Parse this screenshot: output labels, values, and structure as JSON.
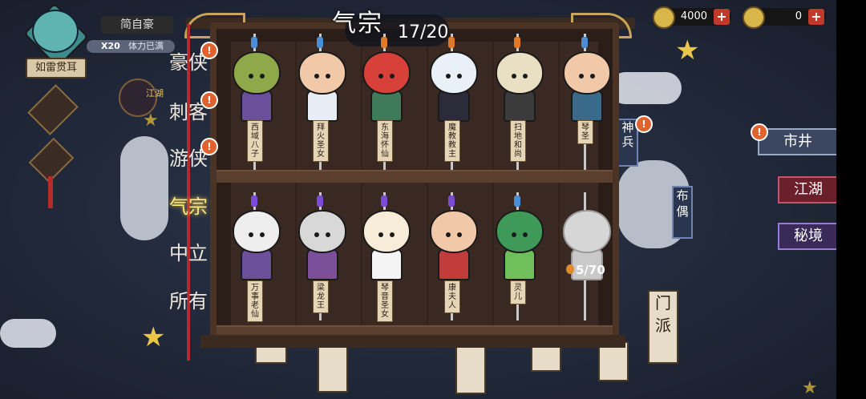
{
  "player": {
    "name": "简自豪",
    "stamina_count": "X20",
    "stamina_status": "体力已满",
    "title": "如雷贯耳"
  },
  "currency": [
    {
      "icon": "leaf-coin-icon",
      "value": "4000"
    },
    {
      "icon": "gold-ingot-icon",
      "value": "0"
    }
  ],
  "collection": {
    "category_label": "气宗",
    "count": "17/20"
  },
  "tabs": [
    {
      "label": "豪侠",
      "badge": "!"
    },
    {
      "label": "刺客",
      "badge": "!"
    },
    {
      "label": "游侠",
      "badge": "!"
    },
    {
      "label": "气宗",
      "badge": ""
    },
    {
      "label": "中立",
      "badge": ""
    },
    {
      "label": "所有",
      "badge": ""
    }
  ],
  "characters_top": [
    {
      "name": "西域八子",
      "head": "#8fa84a",
      "body": "#6b4f9a",
      "bead": "blue"
    },
    {
      "name": "拜火圣女",
      "head": "#f1c9a8",
      "body": "#e8ecf4",
      "bead": "blue"
    },
    {
      "name": "东海怀仙",
      "head": "#d8413a",
      "body": "#3f7a5a",
      "bead": "orange"
    },
    {
      "name": "魔教教主",
      "head": "#e9f0f8",
      "body": "#2b2b3a",
      "bead": "orange"
    },
    {
      "name": "扫地和尚",
      "head": "#e9e0c4",
      "body": "#3b3b3b",
      "bead": "orange"
    },
    {
      "name": "琴圣",
      "head": "#f1c9a8",
      "body": "#3a6a8a",
      "bead": "blue"
    }
  ],
  "characters_bottom": [
    {
      "name": "万事老仙",
      "head": "#eeeeee",
      "body": "#6b4f9a",
      "bead": "purple"
    },
    {
      "name": "梁龙王",
      "head": "#d8d8d8",
      "body": "#7b4f9a",
      "bead": "purple"
    },
    {
      "name": "琴音圣女",
      "head": "#f6ecd8",
      "body": "#f4f4f4",
      "bead": "purple"
    },
    {
      "name": "康夫人",
      "head": "#f1c9a8",
      "body": "#c23b3b",
      "bead": "purple"
    },
    {
      "name": "灵儿",
      "head": "#3f9a5a",
      "body": "#6fbf5a",
      "bead": "blue"
    },
    {
      "name": "",
      "head": "#d6d6d6",
      "body": "#c9c9c9",
      "bead": "none"
    }
  ],
  "locked_progress": "5/70",
  "right_buttons": {
    "shenbing": "神兵",
    "bu_ou": "布偶",
    "shijing": "市井",
    "jianghu": "江湖",
    "mijing": "秘境"
  },
  "decor_text": {
    "left_charm_1": "江湖",
    "menpai": "门派"
  }
}
